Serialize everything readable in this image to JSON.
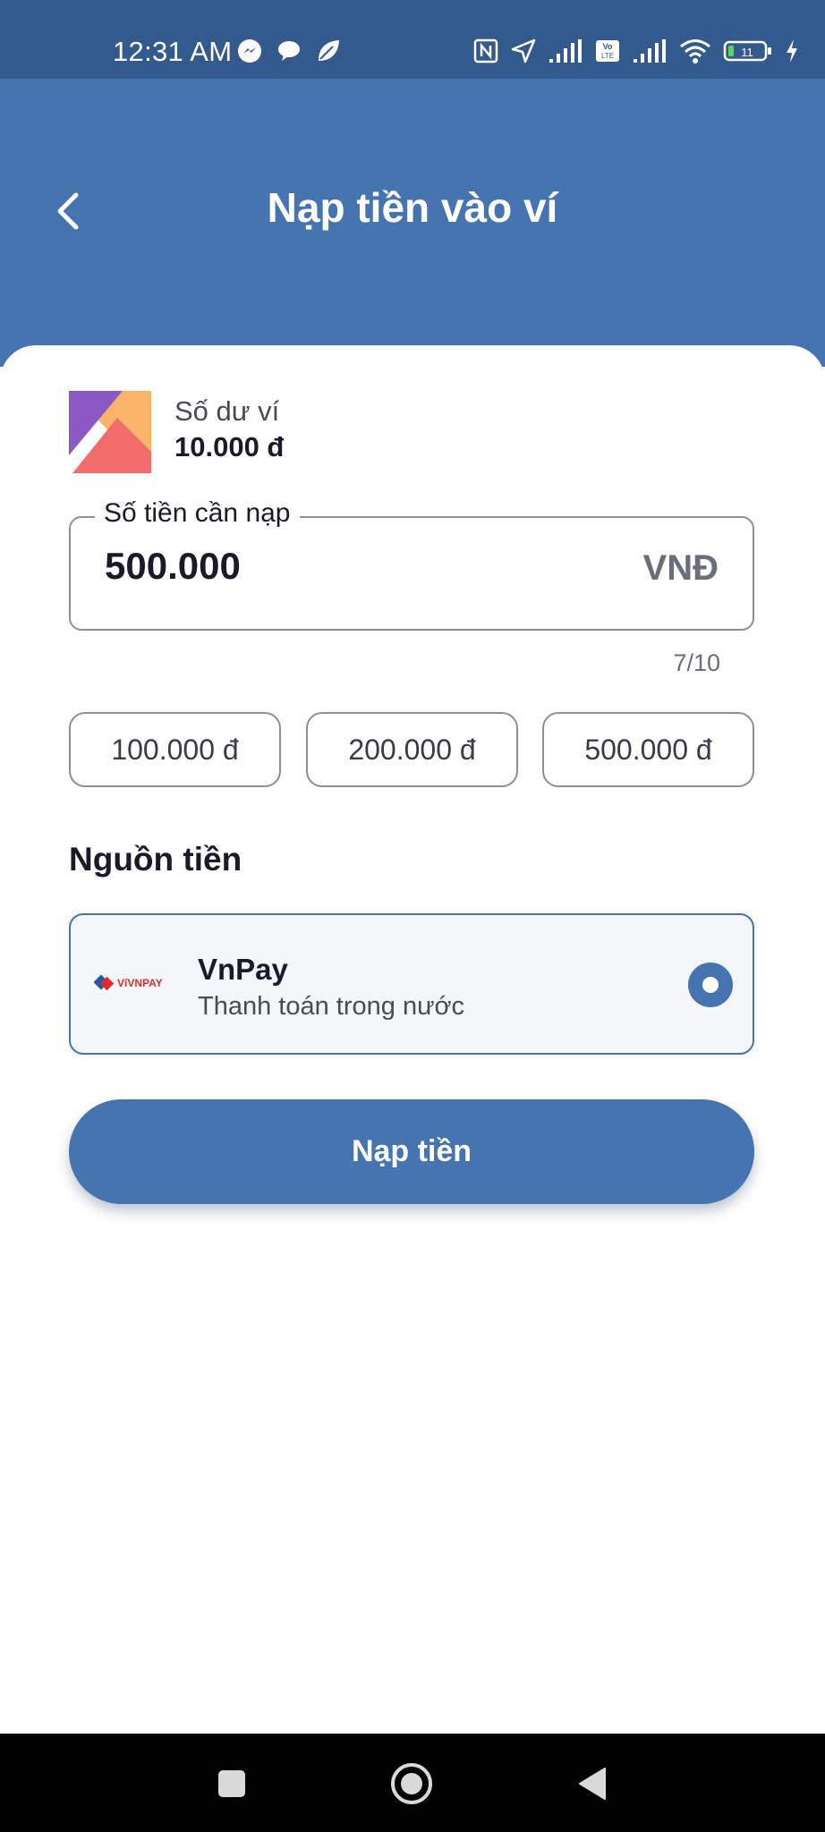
{
  "status_bar": {
    "time": "12:31 AM",
    "left_icons": [
      "messenger-icon",
      "chat-bubble-icon",
      "leaf-icon"
    ],
    "right_icons": [
      "nfc-icon",
      "location-icon",
      "signal-icon",
      "volte-icon",
      "signal-icon",
      "wifi-icon",
      "battery-icon",
      "charging-icon"
    ],
    "battery_level": "11"
  },
  "header": {
    "title": "Nạp tiền vào ví",
    "back_icon": "chevron-left-icon"
  },
  "wallet": {
    "label": "Số dư ví",
    "balance": "10.000 đ"
  },
  "amount_field": {
    "label": "Số tiền cần nạp",
    "value": "500.000",
    "unit": "VNĐ",
    "counter": "7/10"
  },
  "presets": [
    {
      "label": "100.000 đ"
    },
    {
      "label": "200.000 đ"
    },
    {
      "label": "500.000 đ"
    }
  ],
  "funding_source": {
    "title": "Nguồn tiền",
    "name": "VnPay",
    "description": "Thanh toán trong nước",
    "logo_text": "VíVNPAY",
    "selected": true
  },
  "submit_label": "Nạp tiền",
  "colors": {
    "primary": "#4574b0",
    "status_bar": "#325a8c",
    "text_dark": "#1a1a2a"
  },
  "nav_bar": {
    "icons": [
      "square-recents-icon",
      "circle-home-icon",
      "triangle-back-icon"
    ]
  }
}
